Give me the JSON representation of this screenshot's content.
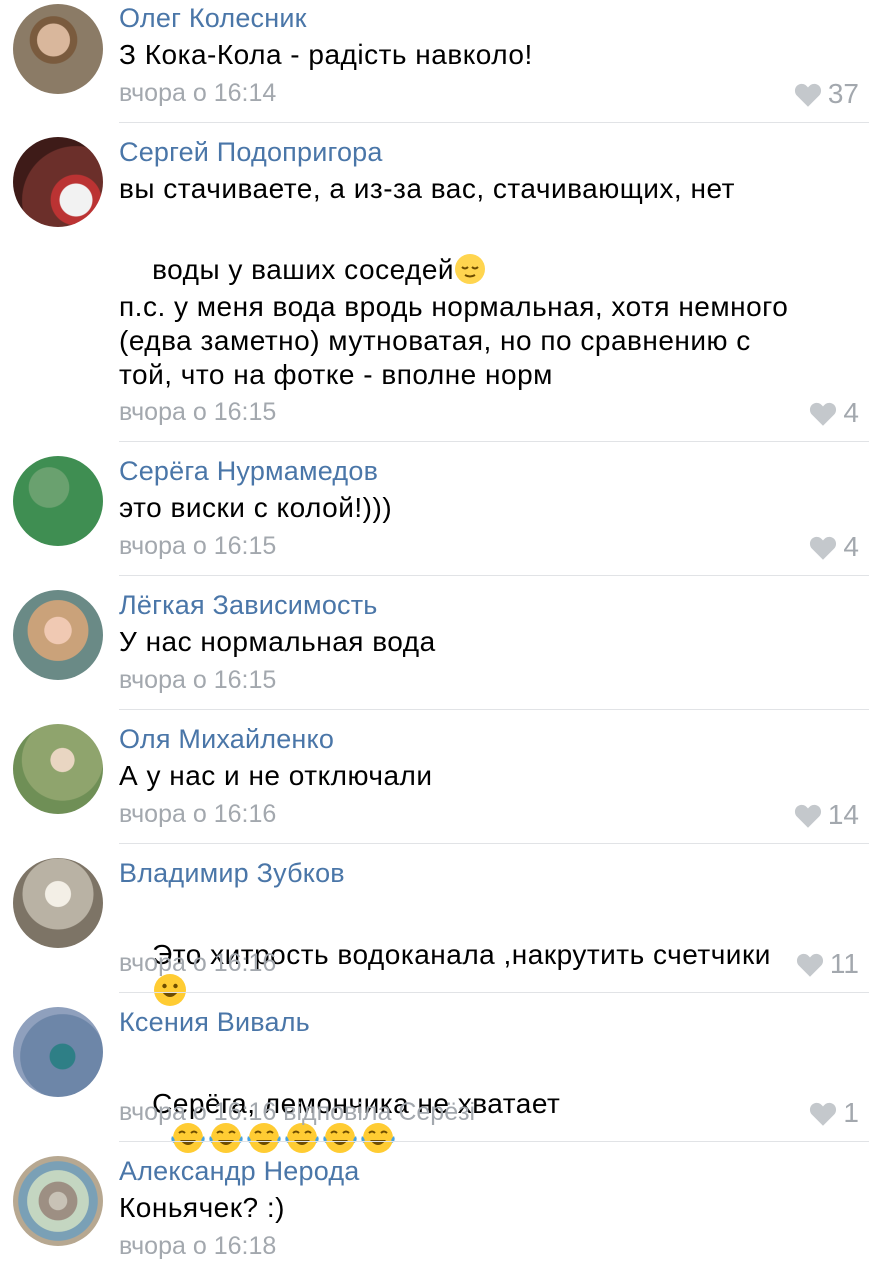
{
  "comments": [
    {
      "author": "Олег Колесник",
      "text": "З Кока-Кола - радість навколо!",
      "time": "вчора о 16:14",
      "likes": "37"
    },
    {
      "author": "Сергей Подопригора",
      "text1": "вы стачиваете, а из-за вас, стачивающих, нет",
      "text2": "воды у ваших соседей",
      "text3": "п.с. у меня вода вродь нормальная, хотя немного\n(едва заметно) мутноватая, но по сравнению с\nтой, что на фотке - вполне норм",
      "time": "вчора о 16:15",
      "likes": "4"
    },
    {
      "author": "Серёга Нурмамедов",
      "text": "это виски с колой!)))",
      "time": "вчора о 16:15",
      "likes": "4"
    },
    {
      "author": "Лёгкая Зависимость",
      "text": "У нас нормальная вода",
      "time": "вчора о 16:15",
      "likes": ""
    },
    {
      "author": "Оля Михайленко",
      "text": "А у нас и не отключали",
      "time": "вчора о 16:16",
      "likes": "14"
    },
    {
      "author": "Владимир Зубков",
      "text": "Это хитрость водоканала ,накрутить счетчики",
      "time": "вчора о 16:16",
      "likes": "11"
    },
    {
      "author": "Ксения Виваль",
      "text": "Серёга, лемончика не хватает",
      "time": "вчора о 16:16 відповіла Серёзі",
      "likes": "1"
    },
    {
      "author": "Александр Нерода",
      "text": "Коньячек? :)",
      "time": "вчора о 16:18",
      "likes": ""
    }
  ],
  "colors": {
    "author": "#4a76a8",
    "meta": "#a3a8ae",
    "divider": "#e1e3e6"
  },
  "icons": {
    "like": "heart-icon"
  }
}
